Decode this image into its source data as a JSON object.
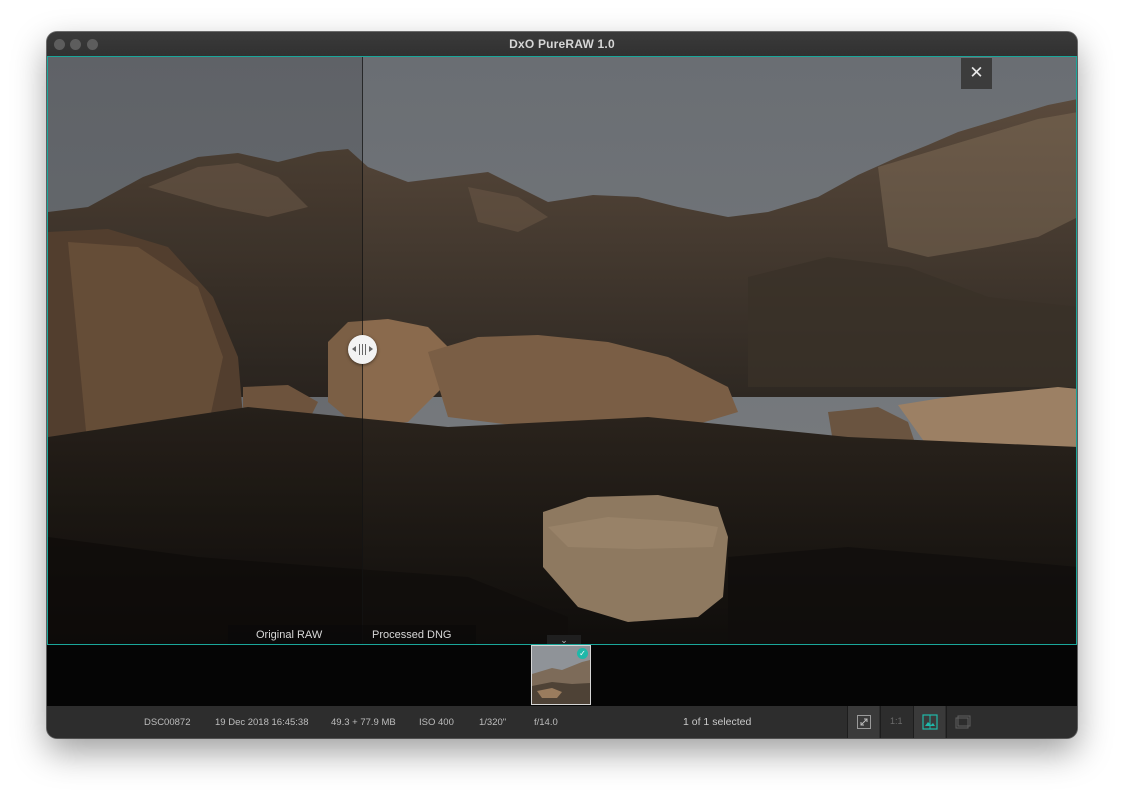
{
  "window": {
    "title": "DxO PureRAW 1.0"
  },
  "viewer": {
    "close_symbol": "✕",
    "labels": {
      "left": "Original RAW",
      "right": "Processed DNG"
    },
    "collapse_symbol": "⌄",
    "accent_color": "#1aa69a"
  },
  "filmstrip": {
    "selected_check": "✓"
  },
  "status": {
    "filename": "DSC00872",
    "date": "19 Dec 2018 16:45:38",
    "size": "49.3 + 77.9 MB",
    "iso": "ISO 400",
    "shutter": "1/320\"",
    "aperture": "f/14.0",
    "selection": "1 of 1 selected"
  },
  "tools": {
    "fit_icon": "fit-to-screen-icon",
    "one_to_one_label": "1:1",
    "compare_icon": "side-by-side-compare-icon",
    "filmstrip_icon": "filmstrip-icon"
  }
}
